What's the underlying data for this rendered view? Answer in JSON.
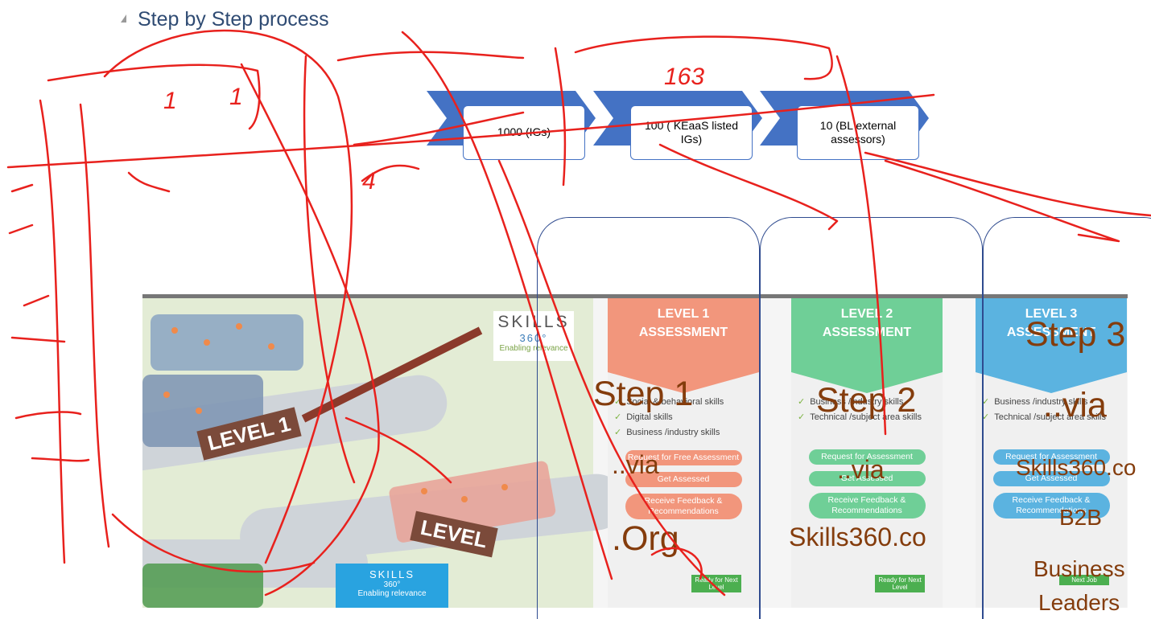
{
  "heading": {
    "title": "Step by Step process"
  },
  "process": {
    "boxes": [
      {
        "label": "1000 (IGs)"
      },
      {
        "label": "100 ( KEaaS listed IGs)"
      },
      {
        "label": "10 (BL external assessors)"
      }
    ],
    "chevron_color": "#4472c4"
  },
  "infographic": {
    "logo": {
      "word": "SKILLS",
      "number": "360°",
      "tagline": "Enabling relevance"
    },
    "signs": [
      "LEVEL 1",
      "LEVEL"
    ],
    "box_text": {
      "word": "SKILLS",
      "number": "360°",
      "tagline": "Enabling relevance"
    },
    "levels": [
      {
        "title1": "LEVEL 1",
        "title2": "ASSESSMENT",
        "color": "#f2967c",
        "skills": [
          "Social & behavioral skills",
          "Digital skills",
          "Business /industry skills"
        ],
        "steps": [
          "Request for Free Assessment",
          "Get Assessed",
          "Receive Feedback & Recommendations"
        ],
        "flag": "Ready for Next Level"
      },
      {
        "title1": "LEVEL 2",
        "title2": "ASSESSMENT",
        "color": "#6fcf97",
        "skills": [
          "Business /industry skills",
          "Technical /subject area skills"
        ],
        "steps": [
          "Request for Assessment",
          "Get Assessed",
          "Receive Feedback & Recommendations"
        ],
        "flag": "Ready for Next Level"
      },
      {
        "title1": "LEVEL 3",
        "title2": "ASSESSMENT",
        "color": "#5bb3e0",
        "skills": [
          "Business /industry skills",
          "Technical /subject area skills"
        ],
        "steps": [
          "Request for Assessment",
          "Get Assessed",
          "Receive Feedback & Recommendations"
        ],
        "flag": "Next Job"
      }
    ]
  },
  "overlays": {
    "step1": "Step 1",
    "via1": "..via",
    "org": ".Org",
    "step2": "Step 2",
    "via2": "..via",
    "site2": "Skills360.co",
    "step3": "Step 3",
    "via3": "..via",
    "site3": "Skills360.co",
    "b2b": "B2B",
    "business": "Business",
    "leaders": "Leaders"
  },
  "handwriting": {
    "n1": "1",
    "n2": "1",
    "n3": "163",
    "n4": "4"
  },
  "colors": {
    "ink": "#e8211d",
    "overlay_text": "#843c0c",
    "bracket": "#2f4b8f"
  }
}
